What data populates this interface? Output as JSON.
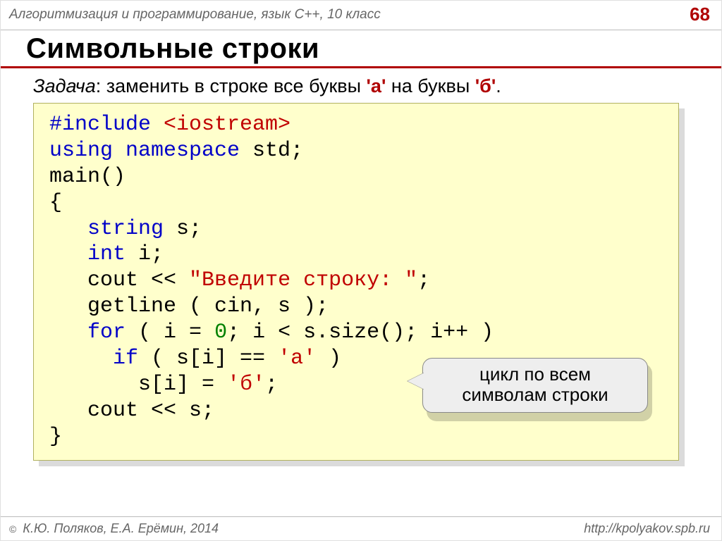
{
  "header": {
    "course": "Алгоритмизация и программирование, язык C++, 10 класс",
    "page_number": "68"
  },
  "title": "Символьные строки",
  "task": {
    "label": "Задача",
    "sep": ": ",
    "t1": "заменить в строке все буквы ",
    "lit_a": "'а'",
    "t2": " на буквы ",
    "lit_b": "'б'",
    "t3": "."
  },
  "code": {
    "l1_pp": "#include ",
    "l1_hdr": "<iostream>",
    "l2_kw": "using namespace ",
    "l2_std": "std",
    "l2_end": ";",
    "l3": "main()",
    "l4": "{",
    "l5_pad": "   ",
    "l5_type": "string",
    "l5_rest": " s;",
    "l6_pad": "   ",
    "l6_type": "int",
    "l6_rest": " i;",
    "l7_pad": "   ",
    "l7_a": "cout << ",
    "l7_str": "\"Введите строку: \"",
    "l7_end": ";",
    "l8": "   getline ( cin, s );",
    "l9_pad": "   ",
    "l9_for": "for",
    "l9_a": " ( i = ",
    "l9_zero": "0",
    "l9_b": "; i < s.size(); i++ )",
    "l10_pad": "     ",
    "l10_if": "if",
    "l10_a": " ( s[i] == ",
    "l10_ch": "'а'",
    "l10_end": " )",
    "l11_pad": "       ",
    "l11_a": "s[i] = ",
    "l11_ch": "'б'",
    "l11_end": ";",
    "l12": "   cout << s;",
    "l13": "}"
  },
  "callout": {
    "line1": "цикл по всем",
    "line2": "символам строки"
  },
  "footer": {
    "authors": " К.Ю. Поляков, Е.А. Ерёмин, 2014",
    "url": "http://kpolyakov.spb.ru"
  }
}
